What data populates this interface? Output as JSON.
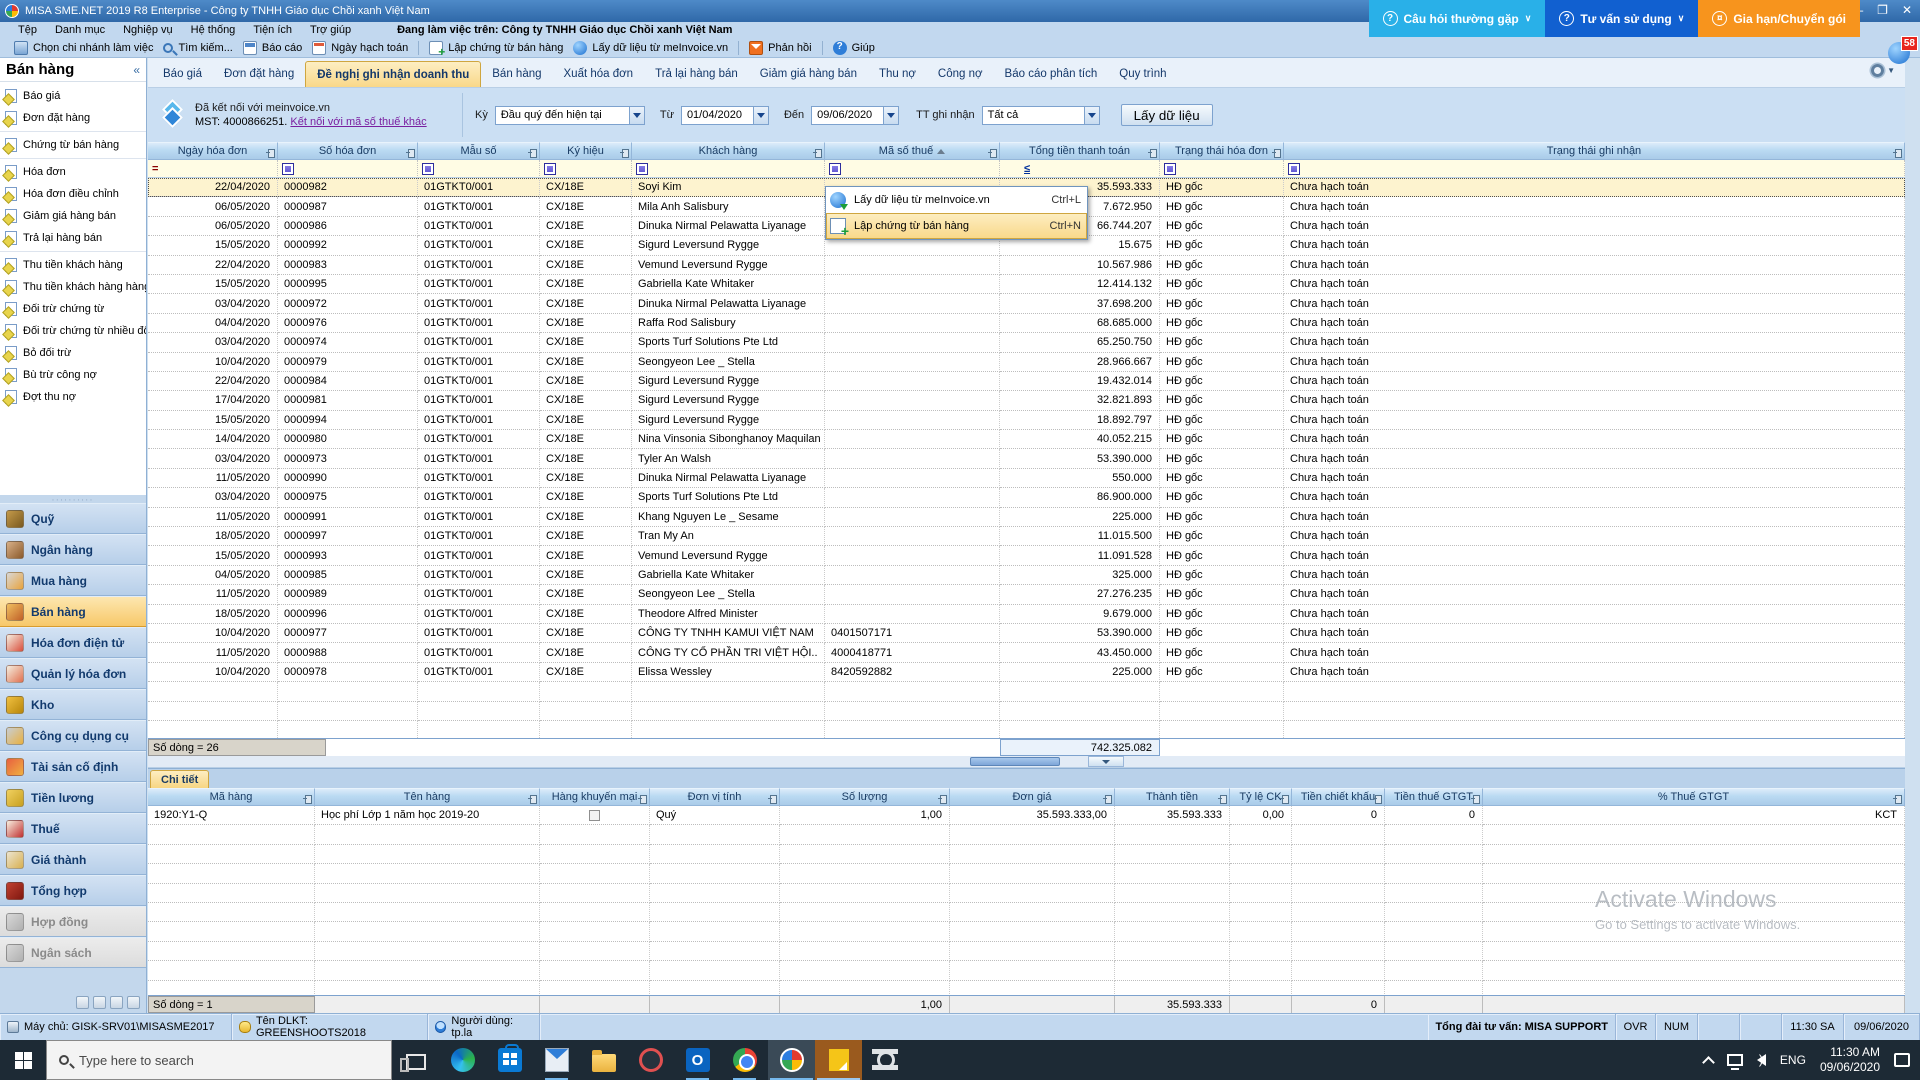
{
  "window": {
    "title": "MISA SME.NET 2019 R8 Enterprise - Công ty TNHH Giáo dục Chồi xanh Việt Nam",
    "minimize": "–",
    "maximize": "❐",
    "close": "✕"
  },
  "top_buttons": {
    "faq": "Câu hỏi thường gặp",
    "advise": "Tư vấn sử dụng",
    "renew": "Gia hạn/Chuyển gói",
    "faq_icon": "question-circle-icon",
    "notification_count": "58"
  },
  "menu": {
    "items": [
      "Tệp",
      "Danh mục",
      "Nghiệp vụ",
      "Hệ thống",
      "Tiện ích",
      "Trợ giúp"
    ],
    "working_on_label": "Đang làm việc trên:",
    "company": "Công ty TNHH Giáo dục Chồi xanh Việt Nam"
  },
  "toolbar": {
    "items": [
      {
        "label": "Chọn chi nhánh làm việc",
        "icon": "branch-icon",
        "sep_before": false
      },
      {
        "label": "Tìm kiếm...",
        "icon": "search-icon",
        "sep_before": false
      },
      {
        "label": "Báo cáo",
        "icon": "report-icon",
        "sep_before": false
      },
      {
        "label": "Ngày hạch toán",
        "icon": "calendar-icon",
        "sep_before": false
      },
      {
        "label": "Lập chứng từ bán hàng",
        "icon": "create-sales-doc-icon",
        "sep_before": true
      },
      {
        "label": "Lấy dữ liệu từ meInvoice.vn",
        "icon": "globe-icon",
        "sep_before": false
      },
      {
        "label": "Phản hồi",
        "icon": "feedback-icon",
        "sep_before": true
      },
      {
        "label": "Giúp",
        "icon": "help-icon",
        "sep_before": true
      }
    ]
  },
  "sidebar": {
    "title": "Bán hàng",
    "collapse_icon": "«",
    "splitter_dots": "∙∙∙∙∙∙∙∙∙∙",
    "groups": [
      [
        "Báo giá",
        "Đơn đặt hàng"
      ],
      [
        "Chứng từ bán hàng"
      ],
      [
        "Hóa đơn",
        "Hóa đơn điều chỉnh",
        "Giảm giá hàng bán",
        "Trả lại hàng bán"
      ],
      [
        "Thu tiền khách hàng",
        "Thu tiền khách hàng hàng l...",
        "Đối trừ chứng từ",
        "Đối trừ chứng từ nhiều đối t...",
        "Bỏ đối trừ",
        "Bù trừ công nợ",
        "Đợt thu nợ"
      ]
    ],
    "modules": [
      {
        "label": "Quỹ",
        "icon": "safe-icon",
        "c1": "#c49a4a",
        "c2": "#7a5a20",
        "state": "normal"
      },
      {
        "label": "Ngân hàng",
        "icon": "bank-icon",
        "c1": "#d8b088",
        "c2": "#8b5a2b",
        "state": "normal"
      },
      {
        "label": "Mua hàng",
        "icon": "cart-icon",
        "c1": "#d8d8d8",
        "c2": "#e8a33d",
        "state": "normal"
      },
      {
        "label": "Bán hàng",
        "icon": "sales-icon",
        "c1": "#f0c060",
        "c2": "#c06028",
        "state": "active"
      },
      {
        "label": "Hóa đơn điện tử",
        "icon": "e-invoice-icon",
        "c1": "#f5efe0",
        "c2": "#d94f3d",
        "state": "normal"
      },
      {
        "label": "Quản lý hóa đơn",
        "icon": "invoice-manager-icon",
        "c1": "#f5efe0",
        "c2": "#e07050",
        "state": "normal"
      },
      {
        "label": "Kho",
        "icon": "warehouse-icon",
        "c1": "#f0c040",
        "c2": "#b8860b",
        "state": "normal"
      },
      {
        "label": "Công cụ dụng cụ",
        "icon": "tools-icon",
        "c1": "#c8ced4",
        "c2": "#e8b040",
        "state": "normal"
      },
      {
        "label": "Tài sản cố định",
        "icon": "fixed-asset-icon",
        "c1": "#e86040",
        "c2": "#f0b040",
        "state": "normal"
      },
      {
        "label": "Tiền lương",
        "icon": "payroll-icon",
        "c1": "#f0d060",
        "c2": "#c8a020",
        "state": "normal"
      },
      {
        "label": "Thuế",
        "icon": "tax-icon",
        "c1": "#f8f0e0",
        "c2": "#c03030",
        "state": "normal"
      },
      {
        "label": "Giá thành",
        "icon": "costing-icon",
        "c1": "#ece4d0",
        "c2": "#d8b050",
        "state": "normal"
      },
      {
        "label": "Tổng hợp",
        "icon": "general-ledger-icon",
        "c1": "#c04030",
        "c2": "#801810",
        "state": "normal"
      },
      {
        "label": "Hợp đồng",
        "icon": "contract-icon",
        "c1": "#d8d8d8",
        "c2": "#b0b0b0",
        "state": "disabled"
      },
      {
        "label": "Ngân sách",
        "icon": "budget-icon",
        "c1": "#d8d8d8",
        "c2": "#b0b0b0",
        "state": "disabled"
      }
    ]
  },
  "tabs": {
    "items": [
      "Báo giá",
      "Đơn đặt hàng",
      "Đề nghị ghi nhận doanh thu",
      "Bán hàng",
      "Xuất hóa đơn",
      "Trả lại hàng bán",
      "Giảm giá hàng bán",
      "Thu nợ",
      "Công nợ",
      "Báo cáo phân tích",
      "Quy trình"
    ],
    "active_index": 2,
    "settings_icon": "gear-icon"
  },
  "filter": {
    "connected_line": "Đã kết nối với meinvoice.vn",
    "mst_line": "MST: 4000866251.",
    "connect_link": "Kết nối với mã số thuế khác",
    "meinvoice_icon": "meinvoice-logo-icon",
    "period_label": "Kỳ",
    "period_value": "Đầu quý đến hiện tại",
    "from_label": "Từ",
    "from_value": "01/04/2020",
    "to_label": "Đến",
    "to_value": "09/06/2020",
    "status_label": "TT ghi nhận",
    "status_value": "Tất cả",
    "fetch_button": "Lấy dữ liệu"
  },
  "grid": {
    "columns": [
      "Ngày hóa đơn",
      "Số hóa đơn",
      "Mẫu số",
      "Ký hiệu",
      "Khách hàng",
      "Mã số thuế",
      "Tổng tiền thanh toán",
      "Trạng thái hóa đơn",
      "Trạng thái ghi nhận"
    ],
    "sorted_column": "Mã số thuế",
    "sort_icon": "sort-asc-icon",
    "header_pin_icon": "pin-icon",
    "filter_ops": {
      "date": "=",
      "amount": "≤"
    },
    "filter_icon": "column-filter-icon",
    "rows": [
      {
        "date": "22/04/2020",
        "no": "0000982",
        "form": "01GTKT0/001",
        "serial": "CX/18E",
        "customer": "Soyi  Kim",
        "tax": "",
        "amount": "35.593.333",
        "inv_status": "HĐ gốc",
        "rec_status": "Chưa hạch toán",
        "selected": true
      },
      {
        "date": "06/05/2020",
        "no": "0000987",
        "form": "01GTKT0/001",
        "serial": "CX/18E",
        "customer": "Mila Anh Salisbury",
        "tax": "",
        "amount": "7.672.950",
        "inv_status": "HĐ gốc",
        "rec_status": "Chưa hạch toán",
        "selected": false
      },
      {
        "date": "06/05/2020",
        "no": "0000986",
        "form": "01GTKT0/001",
        "serial": "CX/18E",
        "customer": "Dinuka Nirmal Pelawatta Liyanage",
        "tax": "",
        "amount": "66.744.207",
        "inv_status": "HĐ gốc",
        "rec_status": "Chưa hạch toán",
        "selected": false
      },
      {
        "date": "15/05/2020",
        "no": "0000992",
        "form": "01GTKT0/001",
        "serial": "CX/18E",
        "customer": "Sigurd Leversund Rygge",
        "tax": "",
        "amount": "15.675",
        "inv_status": "HĐ gốc",
        "rec_status": "Chưa hạch toán",
        "selected": false
      },
      {
        "date": "22/04/2020",
        "no": "0000983",
        "form": "01GTKT0/001",
        "serial": "CX/18E",
        "customer": "Vemund Leversund Rygge",
        "tax": "",
        "amount": "10.567.986",
        "inv_status": "HĐ gốc",
        "rec_status": "Chưa hạch toán",
        "selected": false
      },
      {
        "date": "15/05/2020",
        "no": "0000995",
        "form": "01GTKT0/001",
        "serial": "CX/18E",
        "customer": "Gabriella Kate Whitaker",
        "tax": "",
        "amount": "12.414.132",
        "inv_status": "HĐ gốc",
        "rec_status": "Chưa hạch toán",
        "selected": false
      },
      {
        "date": "03/04/2020",
        "no": "0000972",
        "form": "01GTKT0/001",
        "serial": "CX/18E",
        "customer": "Dinuka Nirmal Pelawatta Liyanage",
        "tax": "",
        "amount": "37.698.200",
        "inv_status": "HĐ gốc",
        "rec_status": "Chưa hạch toán",
        "selected": false
      },
      {
        "date": "04/04/2020",
        "no": "0000976",
        "form": "01GTKT0/001",
        "serial": "CX/18E",
        "customer": "Raffa Rod Salisbury",
        "tax": "",
        "amount": "68.685.000",
        "inv_status": "HĐ gốc",
        "rec_status": "Chưa hạch toán",
        "selected": false
      },
      {
        "date": "03/04/2020",
        "no": "0000974",
        "form": "01GTKT0/001",
        "serial": "CX/18E",
        "customer": "Sports Turf Solutions Pte Ltd",
        "tax": "",
        "amount": "65.250.750",
        "inv_status": "HĐ gốc",
        "rec_status": "Chưa hạch toán",
        "selected": false
      },
      {
        "date": "10/04/2020",
        "no": "0000979",
        "form": "01GTKT0/001",
        "serial": "CX/18E",
        "customer": "Seongyeon Lee _ Stella",
        "tax": "",
        "amount": "28.966.667",
        "inv_status": "HĐ gốc",
        "rec_status": "Chưa hạch toán",
        "selected": false
      },
      {
        "date": "22/04/2020",
        "no": "0000984",
        "form": "01GTKT0/001",
        "serial": "CX/18E",
        "customer": "Sigurd Leversund Rygge",
        "tax": "",
        "amount": "19.432.014",
        "inv_status": "HĐ gốc",
        "rec_status": "Chưa hạch toán",
        "selected": false
      },
      {
        "date": "17/04/2020",
        "no": "0000981",
        "form": "01GTKT0/001",
        "serial": "CX/18E",
        "customer": "Sigurd Leversund Rygge",
        "tax": "",
        "amount": "32.821.893",
        "inv_status": "HĐ gốc",
        "rec_status": "Chưa hạch toán",
        "selected": false
      },
      {
        "date": "15/05/2020",
        "no": "0000994",
        "form": "01GTKT0/001",
        "serial": "CX/18E",
        "customer": "Sigurd Leversund Rygge",
        "tax": "",
        "amount": "18.892.797",
        "inv_status": "HĐ gốc",
        "rec_status": "Chưa hạch toán",
        "selected": false
      },
      {
        "date": "14/04/2020",
        "no": "0000980",
        "form": "01GTKT0/001",
        "serial": "CX/18E",
        "customer": "Nina Vinsonia Sibonghanoy Maquilan",
        "tax": "",
        "amount": "40.052.215",
        "inv_status": "HĐ gốc",
        "rec_status": "Chưa hạch toán",
        "selected": false
      },
      {
        "date": "03/04/2020",
        "no": "0000973",
        "form": "01GTKT0/001",
        "serial": "CX/18E",
        "customer": "Tyler An Walsh",
        "tax": "",
        "amount": "53.390.000",
        "inv_status": "HĐ gốc",
        "rec_status": "Chưa hạch toán",
        "selected": false
      },
      {
        "date": "11/05/2020",
        "no": "0000990",
        "form": "01GTKT0/001",
        "serial": "CX/18E",
        "customer": "Dinuka Nirmal Pelawatta Liyanage",
        "tax": "",
        "amount": "550.000",
        "inv_status": "HĐ gốc",
        "rec_status": "Chưa hạch toán",
        "selected": false
      },
      {
        "date": "03/04/2020",
        "no": "0000975",
        "form": "01GTKT0/001",
        "serial": "CX/18E",
        "customer": "Sports Turf Solutions Pte Ltd",
        "tax": "",
        "amount": "86.900.000",
        "inv_status": "HĐ gốc",
        "rec_status": "Chưa hạch toán",
        "selected": false
      },
      {
        "date": "11/05/2020",
        "no": "0000991",
        "form": "01GTKT0/001",
        "serial": "CX/18E",
        "customer": "Khang Nguyen Le _ Sesame",
        "tax": "",
        "amount": "225.000",
        "inv_status": "HĐ gốc",
        "rec_status": "Chưa hạch toán",
        "selected": false
      },
      {
        "date": "18/05/2020",
        "no": "0000997",
        "form": "01GTKT0/001",
        "serial": "CX/18E",
        "customer": "Tran My An",
        "tax": "",
        "amount": "11.015.500",
        "inv_status": "HĐ gốc",
        "rec_status": "Chưa hạch toán",
        "selected": false
      },
      {
        "date": "15/05/2020",
        "no": "0000993",
        "form": "01GTKT0/001",
        "serial": "CX/18E",
        "customer": "Vemund Leversund Rygge",
        "tax": "",
        "amount": "11.091.528",
        "inv_status": "HĐ gốc",
        "rec_status": "Chưa hạch toán",
        "selected": false
      },
      {
        "date": "04/05/2020",
        "no": "0000985",
        "form": "01GTKT0/001",
        "serial": "CX/18E",
        "customer": "Gabriella Kate Whitaker",
        "tax": "",
        "amount": "325.000",
        "inv_status": "HĐ gốc",
        "rec_status": "Chưa hạch toán",
        "selected": false
      },
      {
        "date": "11/05/2020",
        "no": "0000989",
        "form": "01GTKT0/001",
        "serial": "CX/18E",
        "customer": "Seongyeon Lee _ Stella",
        "tax": "",
        "amount": "27.276.235",
        "inv_status": "HĐ gốc",
        "rec_status": "Chưa hạch toán",
        "selected": false
      },
      {
        "date": "18/05/2020",
        "no": "0000996",
        "form": "01GTKT0/001",
        "serial": "CX/18E",
        "customer": "Theodore Alfred Minister",
        "tax": "",
        "amount": "9.679.000",
        "inv_status": "HĐ gốc",
        "rec_status": "Chưa hạch toán",
        "selected": false
      },
      {
        "date": "10/04/2020",
        "no": "0000977",
        "form": "01GTKT0/001",
        "serial": "CX/18E",
        "customer": "CÔNG TY TNHH KAMUI VIỆT NAM",
        "tax": "0401507171",
        "amount": "53.390.000",
        "inv_status": "HĐ gốc",
        "rec_status": "Chưa hạch toán",
        "selected": false
      },
      {
        "date": "11/05/2020",
        "no": "0000988",
        "form": "01GTKT0/001",
        "serial": "CX/18E",
        "customer": "CÔNG TY CỔ PHẦN TRI VIỆT HỘI..",
        "tax": "4000418771",
        "amount": "43.450.000",
        "inv_status": "HĐ gốc",
        "rec_status": "Chưa hạch toán",
        "selected": false
      },
      {
        "date": "10/04/2020",
        "no": "0000978",
        "form": "01GTKT0/001",
        "serial": "CX/18E",
        "customer": "Elissa Wessley",
        "tax": "8420592882",
        "amount": "225.000",
        "inv_status": "HĐ gốc",
        "rec_status": "Chưa hạch toán",
        "selected": false
      }
    ],
    "summary": {
      "label": "Số dòng = 26",
      "total": "742.325.082"
    }
  },
  "context_menu": {
    "items": [
      {
        "label": "Lấy dữ liệu từ meInvoice.vn",
        "shortcut": "Ctrl+L",
        "icon": "globe-download-icon",
        "highlighted": false
      },
      {
        "label": "Lập chứng từ bán hàng",
        "shortcut": "Ctrl+N",
        "icon": "create-sales-doc-icon",
        "highlighted": true
      }
    ]
  },
  "detail": {
    "tab": "Chi tiết",
    "columns": [
      "Mã hàng",
      "Tên hàng",
      "Hàng khuyến mại",
      "Đơn vị tính",
      "Số lượng",
      "Đơn giá",
      "Thành tiền",
      "Tỷ lệ CK",
      "Tiền chiết khấu",
      "Tiền thuế GTGT",
      "% Thuế GTGT"
    ],
    "rows": [
      {
        "code": "1920:Y1-Q",
        "name": "Học phí Lớp 1 năm học 2019-20",
        "promo": false,
        "unit": "Quý",
        "qty": "1,00",
        "price": "35.593.333,00",
        "amount": "35.593.333",
        "disc_rate": "0,00",
        "disc_amt": "0",
        "vat_amt": "0",
        "vat_rate": "KCT"
      }
    ],
    "summary": {
      "label": "Số dòng = 1",
      "qty": "1,00",
      "amount": "35.593.333",
      "disc_amt": "0"
    }
  },
  "watermark": {
    "line1": "Activate Windows",
    "line2": "Go to Settings to activate Windows."
  },
  "statusbar": {
    "server": "Máy chủ: GISK-SRV01\\MISASME2017",
    "server_icon": "server-icon",
    "db": "Tên DLKT: GREENSHOOTS2018",
    "db_icon": "database-icon",
    "user": "Người dùng: tp.la",
    "user_icon": "user-icon",
    "support": "Tổng đài tư vấn: MISA SUPPORT",
    "ovr": "OVR",
    "num": "NUM",
    "time": "11:30 SA",
    "date": "09/06/2020"
  },
  "taskbar": {
    "search_placeholder": "Type here to search",
    "icons": [
      {
        "name": "task-view-icon",
        "running": false,
        "slot": ""
      },
      {
        "name": "edge-icon",
        "running": false,
        "slot": ""
      },
      {
        "name": "store-icon",
        "running": false,
        "slot": ""
      },
      {
        "name": "mail-icon",
        "running": true,
        "slot": ""
      },
      {
        "name": "file-explorer-icon",
        "running": false,
        "slot": ""
      },
      {
        "name": "snip-icon",
        "running": false,
        "slot": ""
      },
      {
        "name": "outlook-icon",
        "running": true,
        "slot": ""
      },
      {
        "name": "chrome-icon",
        "running": true,
        "slot": ""
      },
      {
        "name": "misa-amis-icon",
        "running": true,
        "slot": "dark"
      },
      {
        "name": "misa-sme-icon",
        "running": true,
        "slot": "orange"
      },
      {
        "name": "settings-icon",
        "running": false,
        "slot": ""
      }
    ],
    "tray": {
      "lang": "ENG",
      "time": "11:30 AM",
      "date": "09/06/2020"
    }
  }
}
